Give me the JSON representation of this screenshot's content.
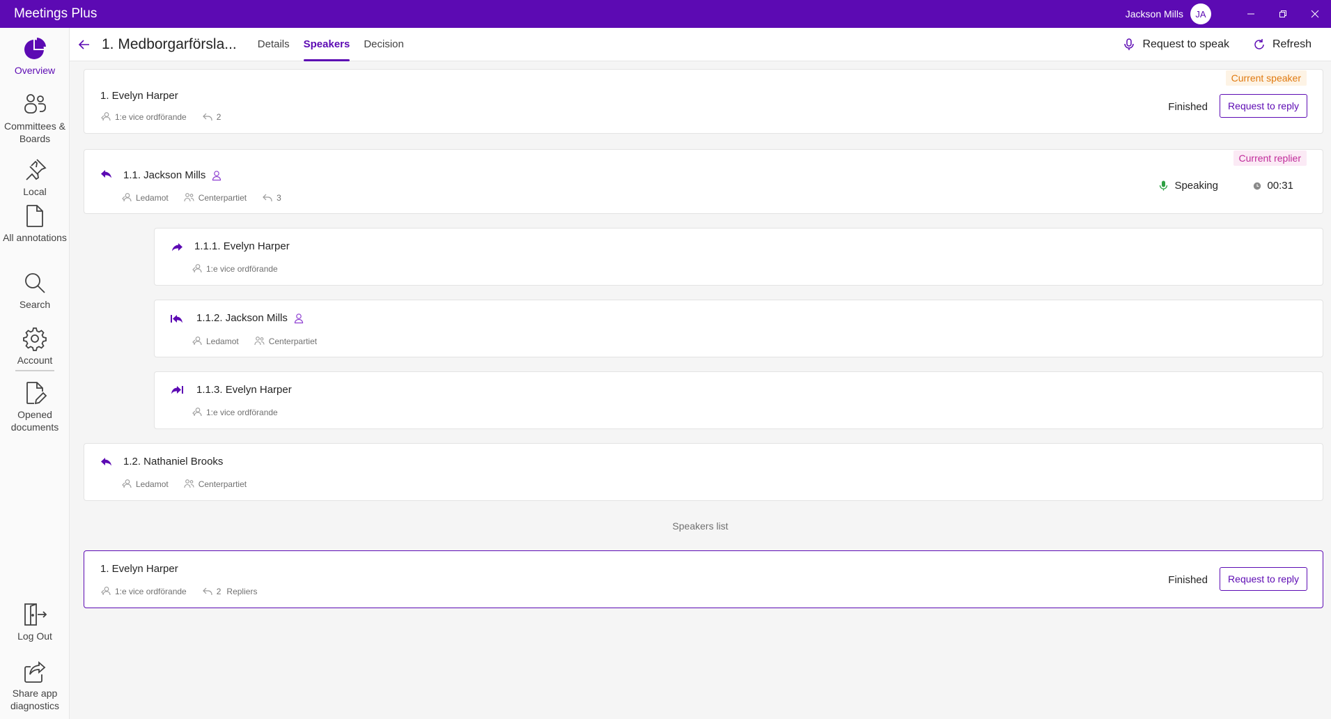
{
  "app": {
    "title": "Meetings Plus"
  },
  "user": {
    "name": "Jackson Mills",
    "initials": "JA"
  },
  "colors": {
    "accent": "#5c0ab3",
    "current_speaker": "#e07a10",
    "current_replier": "#c02a9a",
    "speaking": "#2ea043"
  },
  "sidebar": {
    "items": [
      {
        "label": "Overview",
        "icon": "pie-chart-icon"
      },
      {
        "label": "Committees & Boards",
        "icon": "people-group-icon"
      },
      {
        "label": "Local",
        "icon": "pin-icon"
      },
      {
        "label": "All annotations",
        "icon": "document-icon"
      },
      {
        "label": "Search",
        "icon": "search-icon"
      },
      {
        "label": "Account",
        "icon": "gear-icon"
      },
      {
        "label": "Opened documents",
        "icon": "document-edit-icon"
      }
    ],
    "bottom": [
      {
        "label": "Log Out",
        "icon": "logout-icon"
      },
      {
        "label": "Share app diagnostics",
        "icon": "share-icon"
      }
    ]
  },
  "header": {
    "title": "1. Medborgarförsla...",
    "tabs": [
      "Details",
      "Speakers",
      "Decision"
    ],
    "active_tab": "Speakers",
    "request_to_speak": "Request to speak",
    "refresh": "Refresh"
  },
  "speakers": [
    {
      "name": "1. Evelyn Harper",
      "role": "1:e vice ordförande",
      "replies": "2",
      "badge": "Current speaker",
      "status": "Finished",
      "button": "Request to reply"
    },
    {
      "name": "1.1. Jackson Mills",
      "role": "Ledamot",
      "party": "Centerpartiet",
      "replies": "3",
      "badge": "Current replier",
      "speaking_label": "Speaking",
      "timer": "00:31"
    },
    {
      "name": "1.1.1. Evelyn Harper",
      "role": "1:e vice ordförande"
    },
    {
      "name": "1.1.2. Jackson Mills",
      "role": "Ledamot",
      "party": "Centerpartiet"
    },
    {
      "name": "1.1.3. Evelyn Harper",
      "role": "1:e vice ordförande"
    },
    {
      "name": "1.2. Nathaniel Brooks",
      "role": "Ledamot",
      "party": "Centerpartiet"
    }
  ],
  "speakers_list": {
    "label": "Speakers list",
    "items": [
      {
        "name": "1. Evelyn Harper",
        "role": "1:e vice ordförande",
        "replies": "2",
        "replies_label": "Repliers",
        "status": "Finished",
        "button": "Request to reply"
      }
    ]
  }
}
